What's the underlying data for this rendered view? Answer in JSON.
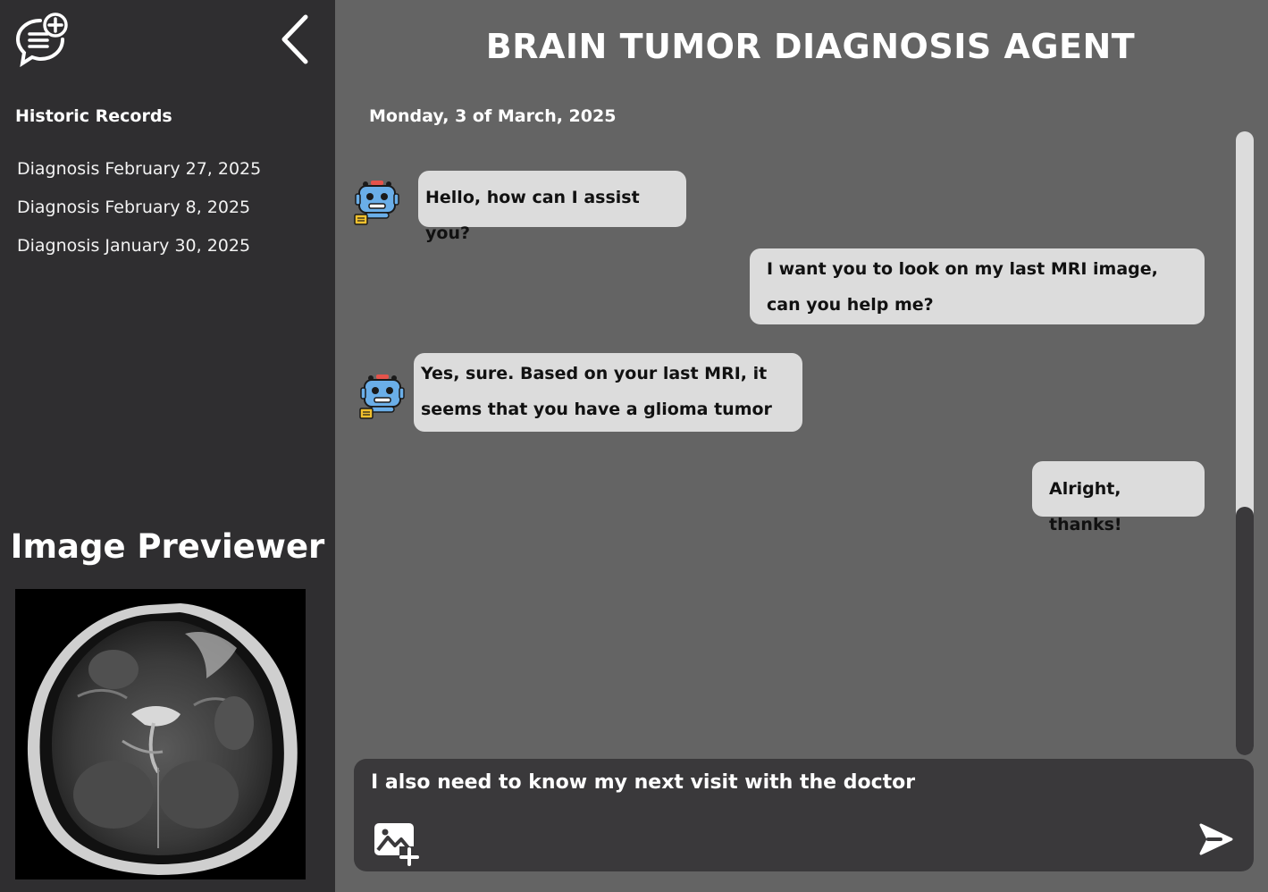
{
  "sidebar": {
    "history_title": "Historic Records",
    "items": [
      {
        "label": "Diagnosis February 27, 2025"
      },
      {
        "label": "Diagnosis February 8, 2025"
      },
      {
        "label": "Diagnosis January 30, 2025"
      }
    ],
    "previewer_title": "Image Previewer"
  },
  "header": {
    "title": "BRAIN TUMOR DIAGNOSIS AGENT"
  },
  "chat": {
    "date": "Monday, 3 of March, 2025",
    "messages": [
      {
        "role": "bot",
        "text": "Hello, how can I assist you?"
      },
      {
        "role": "user",
        "text": "I want you to look on my last MRI image, can you help me?"
      },
      {
        "role": "bot",
        "text": "Yes, sure. Based on your last MRI, it seems that you have a glioma tumor"
      },
      {
        "role": "user",
        "text": "Alright, thanks!"
      }
    ]
  },
  "composer": {
    "value": "I also need to know my next visit with the doctor"
  },
  "icons": {
    "new_chat": "new-chat-icon",
    "collapse": "chevron-left-icon",
    "bot": "robot-icon",
    "attach": "add-image-icon",
    "send": "send-icon"
  },
  "colors": {
    "sidebar_bg": "#2f2e30",
    "main_bg": "#646464",
    "bubble_bg": "#dcdcdc",
    "composer_bg": "#3a393b"
  }
}
